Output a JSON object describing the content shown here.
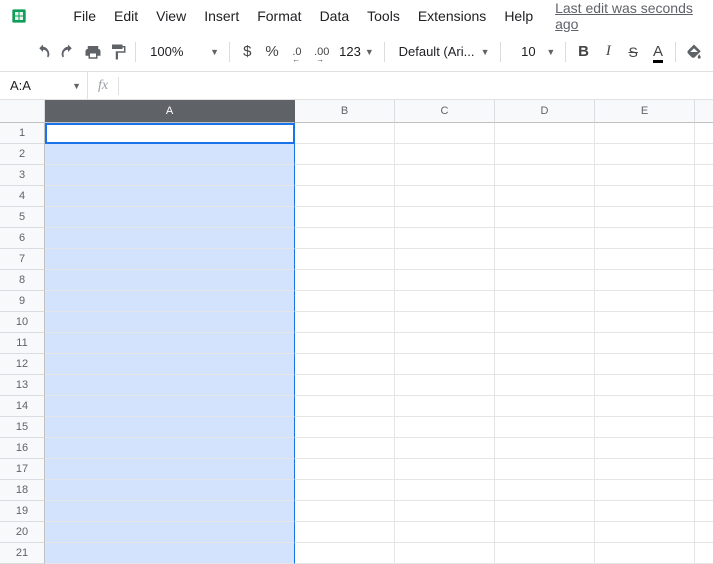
{
  "menu": {
    "items": [
      "File",
      "Edit",
      "View",
      "Insert",
      "Format",
      "Data",
      "Tools",
      "Extensions",
      "Help"
    ],
    "last_edit": "Last edit was seconds ago"
  },
  "toolbar": {
    "zoom": "100%",
    "font": "Default (Ari...",
    "font_size": "10",
    "currency": "$",
    "percent": "%",
    "decrease_dec": ".0",
    "increase_dec": ".00",
    "num_format": "123"
  },
  "formula_bar": {
    "name_box": "A:A",
    "fx": "fx",
    "value": ""
  },
  "columns": [
    "A",
    "B",
    "C",
    "D",
    "E"
  ],
  "selected_column": "A",
  "rows": [
    1,
    2,
    3,
    4,
    5,
    6,
    7,
    8,
    9,
    10,
    11,
    12,
    13,
    14,
    15,
    16,
    17,
    18,
    19,
    20,
    21
  ]
}
